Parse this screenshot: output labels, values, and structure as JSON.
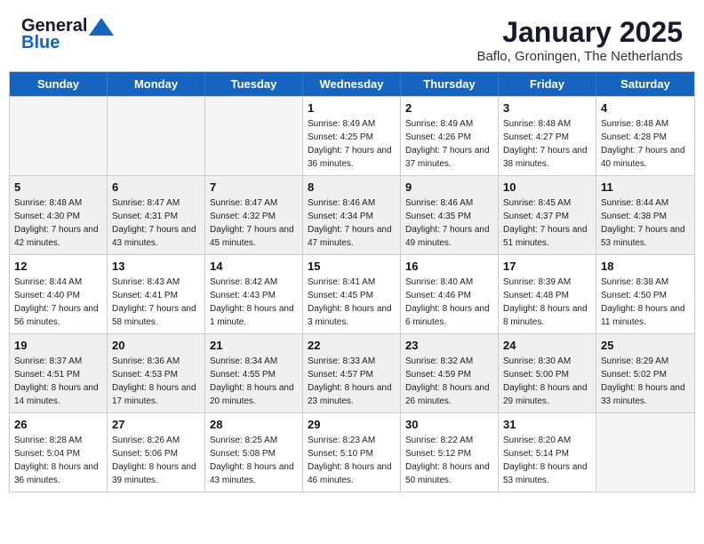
{
  "logo": {
    "general": "General",
    "blue": "Blue"
  },
  "title": "January 2025",
  "subtitle": "Baflo, Groningen, The Netherlands",
  "days": [
    "Sunday",
    "Monday",
    "Tuesday",
    "Wednesday",
    "Thursday",
    "Friday",
    "Saturday"
  ],
  "weeks": [
    [
      {
        "day": "",
        "empty": true
      },
      {
        "day": "",
        "empty": true
      },
      {
        "day": "",
        "empty": true
      },
      {
        "day": "1",
        "sunrise": "8:49 AM",
        "sunset": "4:25 PM",
        "daylight": "7 hours and 36 minutes."
      },
      {
        "day": "2",
        "sunrise": "8:49 AM",
        "sunset": "4:26 PM",
        "daylight": "7 hours and 37 minutes."
      },
      {
        "day": "3",
        "sunrise": "8:48 AM",
        "sunset": "4:27 PM",
        "daylight": "7 hours and 38 minutes."
      },
      {
        "day": "4",
        "sunrise": "8:48 AM",
        "sunset": "4:28 PM",
        "daylight": "7 hours and 40 minutes."
      }
    ],
    [
      {
        "day": "5",
        "sunrise": "8:48 AM",
        "sunset": "4:30 PM",
        "daylight": "7 hours and 42 minutes."
      },
      {
        "day": "6",
        "sunrise": "8:47 AM",
        "sunset": "4:31 PM",
        "daylight": "7 hours and 43 minutes."
      },
      {
        "day": "7",
        "sunrise": "8:47 AM",
        "sunset": "4:32 PM",
        "daylight": "7 hours and 45 minutes."
      },
      {
        "day": "8",
        "sunrise": "8:46 AM",
        "sunset": "4:34 PM",
        "daylight": "7 hours and 47 minutes."
      },
      {
        "day": "9",
        "sunrise": "8:46 AM",
        "sunset": "4:35 PM",
        "daylight": "7 hours and 49 minutes."
      },
      {
        "day": "10",
        "sunrise": "8:45 AM",
        "sunset": "4:37 PM",
        "daylight": "7 hours and 51 minutes."
      },
      {
        "day": "11",
        "sunrise": "8:44 AM",
        "sunset": "4:38 PM",
        "daylight": "7 hours and 53 minutes."
      }
    ],
    [
      {
        "day": "12",
        "sunrise": "8:44 AM",
        "sunset": "4:40 PM",
        "daylight": "7 hours and 56 minutes."
      },
      {
        "day": "13",
        "sunrise": "8:43 AM",
        "sunset": "4:41 PM",
        "daylight": "7 hours and 58 minutes."
      },
      {
        "day": "14",
        "sunrise": "8:42 AM",
        "sunset": "4:43 PM",
        "daylight": "8 hours and 1 minute."
      },
      {
        "day": "15",
        "sunrise": "8:41 AM",
        "sunset": "4:45 PM",
        "daylight": "8 hours and 3 minutes."
      },
      {
        "day": "16",
        "sunrise": "8:40 AM",
        "sunset": "4:46 PM",
        "daylight": "8 hours and 6 minutes."
      },
      {
        "day": "17",
        "sunrise": "8:39 AM",
        "sunset": "4:48 PM",
        "daylight": "8 hours and 8 minutes."
      },
      {
        "day": "18",
        "sunrise": "8:38 AM",
        "sunset": "4:50 PM",
        "daylight": "8 hours and 11 minutes."
      }
    ],
    [
      {
        "day": "19",
        "sunrise": "8:37 AM",
        "sunset": "4:51 PM",
        "daylight": "8 hours and 14 minutes."
      },
      {
        "day": "20",
        "sunrise": "8:36 AM",
        "sunset": "4:53 PM",
        "daylight": "8 hours and 17 minutes."
      },
      {
        "day": "21",
        "sunrise": "8:34 AM",
        "sunset": "4:55 PM",
        "daylight": "8 hours and 20 minutes."
      },
      {
        "day": "22",
        "sunrise": "8:33 AM",
        "sunset": "4:57 PM",
        "daylight": "8 hours and 23 minutes."
      },
      {
        "day": "23",
        "sunrise": "8:32 AM",
        "sunset": "4:59 PM",
        "daylight": "8 hours and 26 minutes."
      },
      {
        "day": "24",
        "sunrise": "8:30 AM",
        "sunset": "5:00 PM",
        "daylight": "8 hours and 29 minutes."
      },
      {
        "day": "25",
        "sunrise": "8:29 AM",
        "sunset": "5:02 PM",
        "daylight": "8 hours and 33 minutes."
      }
    ],
    [
      {
        "day": "26",
        "sunrise": "8:28 AM",
        "sunset": "5:04 PM",
        "daylight": "8 hours and 36 minutes."
      },
      {
        "day": "27",
        "sunrise": "8:26 AM",
        "sunset": "5:06 PM",
        "daylight": "8 hours and 39 minutes."
      },
      {
        "day": "28",
        "sunrise": "8:25 AM",
        "sunset": "5:08 PM",
        "daylight": "8 hours and 43 minutes."
      },
      {
        "day": "29",
        "sunrise": "8:23 AM",
        "sunset": "5:10 PM",
        "daylight": "8 hours and 46 minutes."
      },
      {
        "day": "30",
        "sunrise": "8:22 AM",
        "sunset": "5:12 PM",
        "daylight": "8 hours and 50 minutes."
      },
      {
        "day": "31",
        "sunrise": "8:20 AM",
        "sunset": "5:14 PM",
        "daylight": "8 hours and 53 minutes."
      },
      {
        "day": "",
        "empty": true
      }
    ]
  ]
}
